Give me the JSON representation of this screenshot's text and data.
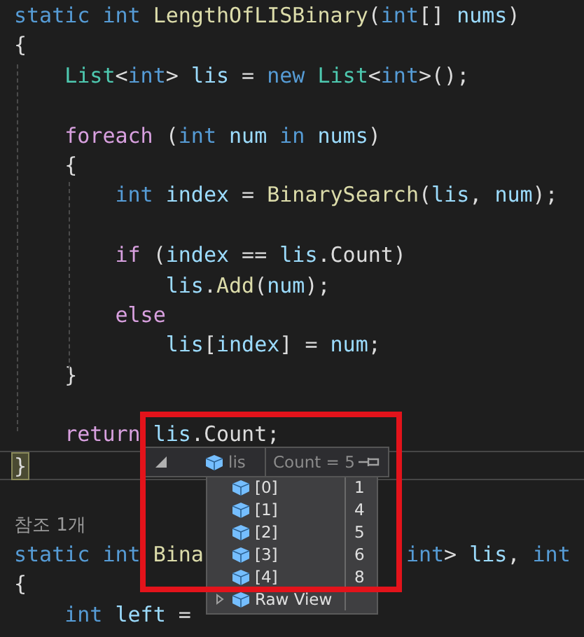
{
  "code_lines": [
    {
      "kind": "code",
      "tokens": [
        {
          "text": "static int ",
          "kind": "keyword"
        },
        {
          "text": "LengthOfLISBinary",
          "kind": "method"
        },
        {
          "text": "(",
          "kind": "punct"
        },
        {
          "text": "int",
          "kind": "keyword"
        },
        {
          "text": "[] ",
          "kind": "punct"
        },
        {
          "text": "nums",
          "kind": "variable"
        },
        {
          "text": ")",
          "kind": "punct"
        }
      ]
    },
    {
      "kind": "code",
      "tokens": [
        {
          "text": "{",
          "kind": "punct"
        }
      ]
    },
    {
      "kind": "code",
      "tokens": [
        {
          "text": "    List",
          "kind": "type"
        },
        {
          "text": "<",
          "kind": "punct"
        },
        {
          "text": "int",
          "kind": "keyword"
        },
        {
          "text": "> ",
          "kind": "punct"
        },
        {
          "text": "lis",
          "kind": "variable"
        },
        {
          "text": " = ",
          "kind": "punct"
        },
        {
          "text": "new ",
          "kind": "keyword"
        },
        {
          "text": "List",
          "kind": "type"
        },
        {
          "text": "<",
          "kind": "punct"
        },
        {
          "text": "int",
          "kind": "keyword"
        },
        {
          "text": ">();",
          "kind": "punct"
        }
      ]
    },
    {
      "kind": "blank"
    },
    {
      "kind": "code",
      "tokens": [
        {
          "text": "    foreach",
          "kind": "control"
        },
        {
          "text": " (",
          "kind": "punct"
        },
        {
          "text": "int ",
          "kind": "keyword"
        },
        {
          "text": "num ",
          "kind": "variable"
        },
        {
          "text": "in",
          "kind": "keyword"
        },
        {
          "text": " nums",
          "kind": "variable"
        },
        {
          "text": ")",
          "kind": "punct"
        }
      ]
    },
    {
      "kind": "code",
      "tokens": [
        {
          "text": "    {",
          "kind": "punct"
        }
      ]
    },
    {
      "kind": "code",
      "tokens": [
        {
          "text": "        int ",
          "kind": "keyword"
        },
        {
          "text": "index",
          "kind": "variable"
        },
        {
          "text": " = ",
          "kind": "punct"
        },
        {
          "text": "BinarySearch",
          "kind": "method"
        },
        {
          "text": "(",
          "kind": "punct"
        },
        {
          "text": "lis",
          "kind": "variable"
        },
        {
          "text": ", ",
          "kind": "punct"
        },
        {
          "text": "num",
          "kind": "variable"
        },
        {
          "text": ");",
          "kind": "punct"
        }
      ]
    },
    {
      "kind": "blank"
    },
    {
      "kind": "code",
      "tokens": [
        {
          "text": "        if",
          "kind": "control"
        },
        {
          "text": " (",
          "kind": "punct"
        },
        {
          "text": "index",
          "kind": "variable"
        },
        {
          "text": " == ",
          "kind": "punct"
        },
        {
          "text": "lis",
          "kind": "variable"
        },
        {
          "text": ".Count)",
          "kind": "punct"
        }
      ]
    },
    {
      "kind": "code",
      "tokens": [
        {
          "text": "            lis",
          "kind": "variable"
        },
        {
          "text": ".",
          "kind": "punct"
        },
        {
          "text": "Add",
          "kind": "method"
        },
        {
          "text": "(",
          "kind": "punct"
        },
        {
          "text": "num",
          "kind": "variable"
        },
        {
          "text": ");",
          "kind": "punct"
        }
      ]
    },
    {
      "kind": "code",
      "tokens": [
        {
          "text": "        else",
          "kind": "control"
        }
      ]
    },
    {
      "kind": "code",
      "tokens": [
        {
          "text": "            lis",
          "kind": "variable"
        },
        {
          "text": "[",
          "kind": "punct"
        },
        {
          "text": "index",
          "kind": "variable"
        },
        {
          "text": "] = ",
          "kind": "punct"
        },
        {
          "text": "num",
          "kind": "variable"
        },
        {
          "text": ";",
          "kind": "punct"
        }
      ]
    },
    {
      "kind": "code",
      "tokens": [
        {
          "text": "    }",
          "kind": "punct"
        }
      ]
    },
    {
      "kind": "blank"
    },
    {
      "kind": "code",
      "tokens": [
        {
          "text": "    return ",
          "kind": "control"
        },
        {
          "text": "lis",
          "kind": "variable"
        },
        {
          "text": ".Count;",
          "kind": "punct"
        }
      ]
    },
    {
      "kind": "current",
      "tokens": [
        {
          "text": "}",
          "kind": "brace-match"
        }
      ]
    },
    {
      "kind": "blank"
    },
    {
      "kind": "codelens",
      "tokens": [
        {
          "text": "참조 1개",
          "kind": "lens"
        }
      ]
    },
    {
      "kind": "code",
      "tokens": [
        {
          "text": "static int ",
          "kind": "keyword"
        },
        {
          "text": "Bina",
          "kind": "method"
        },
        {
          "kind": "hidden"
        },
        {
          "text": "int",
          "kind": "keyword"
        },
        {
          "text": "> ",
          "kind": "punct"
        },
        {
          "text": "lis",
          "kind": "variable"
        },
        {
          "text": ", ",
          "kind": "punct"
        },
        {
          "text": "int",
          "kind": "keyword"
        }
      ]
    },
    {
      "kind": "code",
      "tokens": [
        {
          "text": "{",
          "kind": "punct"
        }
      ]
    },
    {
      "kind": "code",
      "tokens": [
        {
          "text": "    int ",
          "kind": "keyword"
        },
        {
          "text": "left",
          "kind": "variable"
        },
        {
          "text": " =",
          "kind": "punct"
        }
      ]
    }
  ],
  "datatip": {
    "name": "lis",
    "value": "Count = 5",
    "expanded": true,
    "items": [
      {
        "name": "[0]",
        "value": "1"
      },
      {
        "name": "[1]",
        "value": "4"
      },
      {
        "name": "[2]",
        "value": "5"
      },
      {
        "name": "[3]",
        "value": "6"
      },
      {
        "name": "[4]",
        "value": "8"
      }
    ],
    "raw_view": "Raw View"
  }
}
